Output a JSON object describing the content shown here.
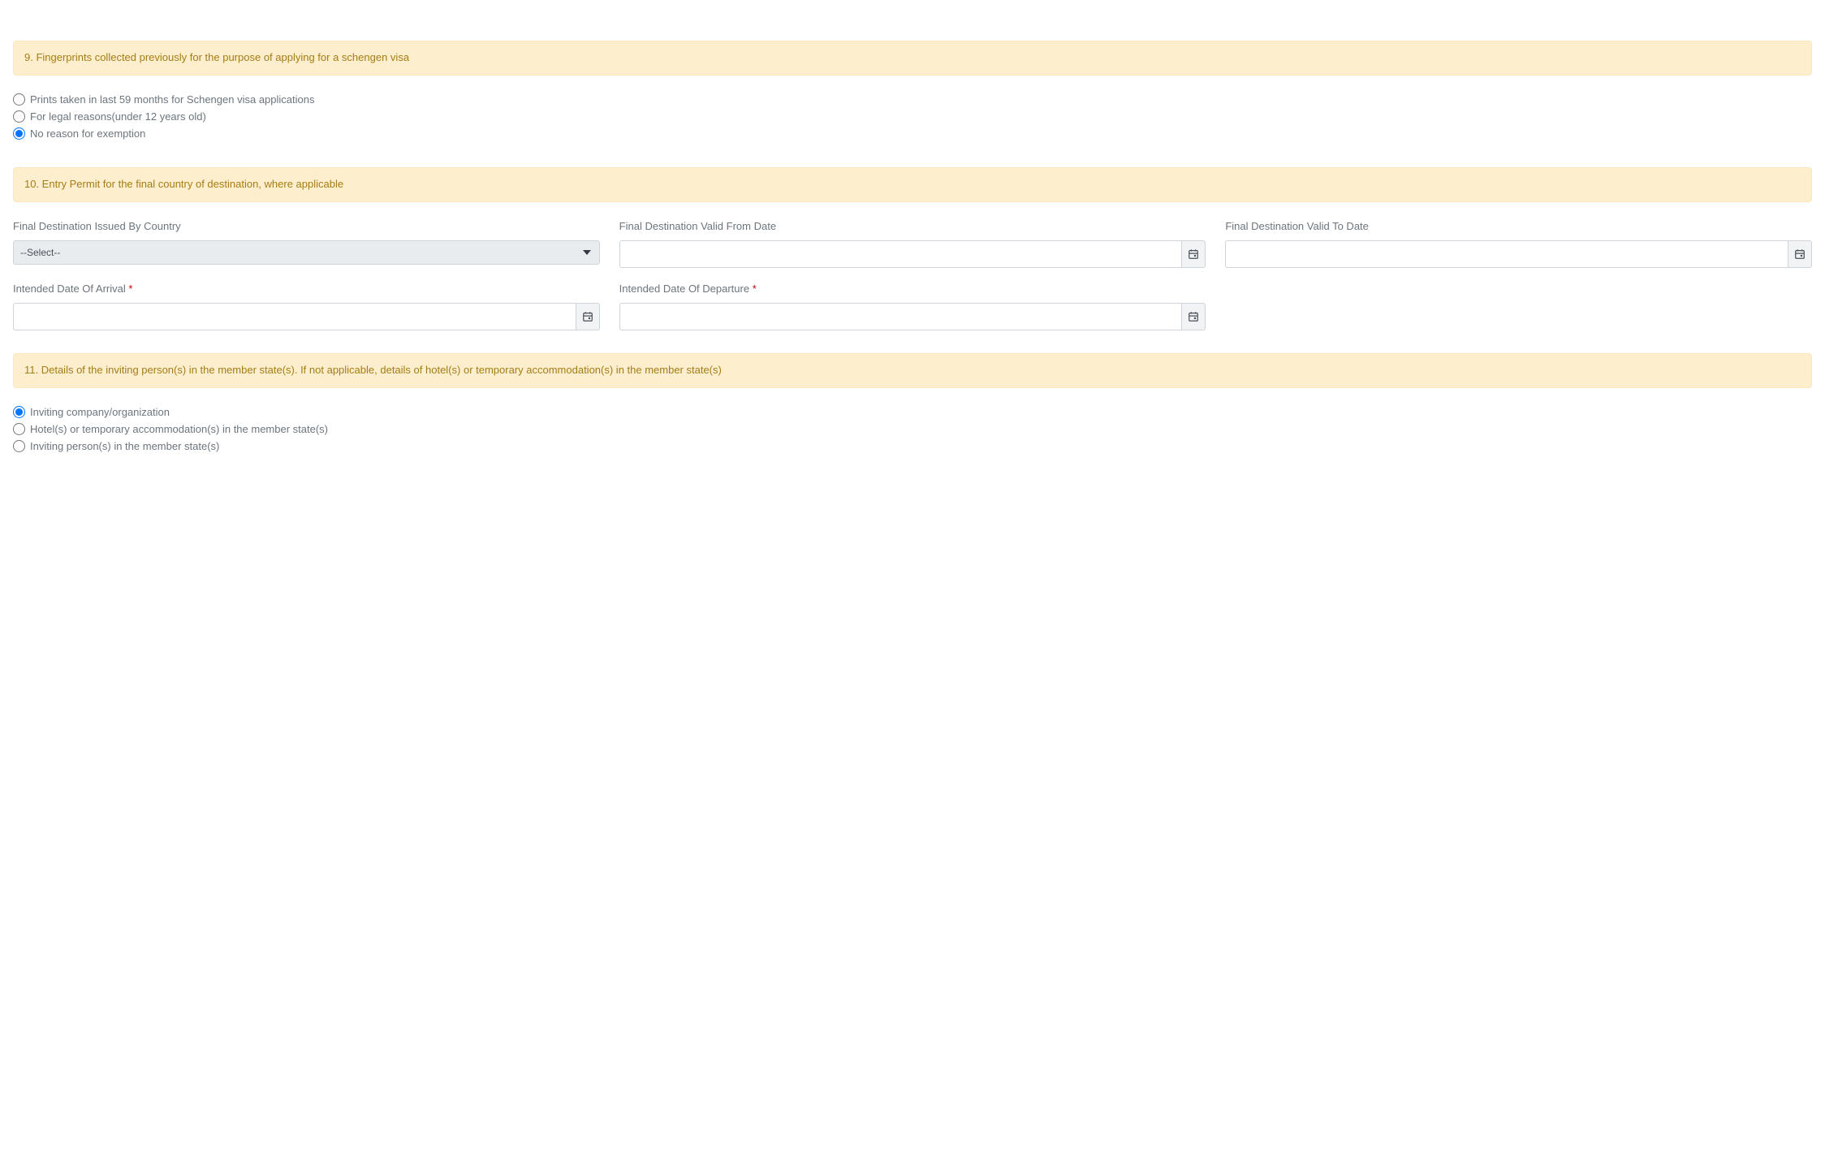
{
  "section9": {
    "title": "9. Fingerprints collected previously for the purpose of applying for a schengen visa",
    "options": [
      {
        "label": "Prints taken in last 59 months for Schengen visa applications",
        "checked": false
      },
      {
        "label": "For legal reasons(under 12 years old)",
        "checked": false
      },
      {
        "label": "No reason for exemption",
        "checked": true
      }
    ]
  },
  "section10": {
    "title": "10. Entry Permit for the final country of destination, where applicable",
    "fields": {
      "issuedByCountry": {
        "label": "Final Destination Issued By Country",
        "placeholder": "--Select--",
        "value": ""
      },
      "validFrom": {
        "label": "Final Destination Valid From Date",
        "value": ""
      },
      "validTo": {
        "label": "Final Destination Valid To Date",
        "value": ""
      },
      "arrival": {
        "label": "Intended Date Of Arrival",
        "required": true,
        "value": ""
      },
      "departure": {
        "label": "Intended Date Of Departure",
        "required": true,
        "value": ""
      }
    }
  },
  "section11": {
    "title": "11. Details of the inviting person(s) in the member state(s). If not applicable, details of hotel(s) or temporary accommodation(s) in the member state(s)",
    "options": [
      {
        "label": "Inviting company/organization",
        "checked": true
      },
      {
        "label": "Hotel(s) or temporary accommodation(s) in the member state(s)",
        "checked": false
      },
      {
        "label": "Inviting person(s) in the member state(s)",
        "checked": false
      }
    ]
  },
  "requiredMark": "*"
}
